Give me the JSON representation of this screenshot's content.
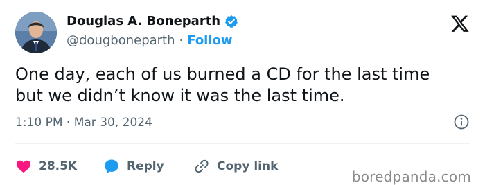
{
  "author": {
    "display_name": "Douglas A. Boneparth",
    "handle": "@dougboneparth",
    "separator": "·",
    "follow_label": "Follow"
  },
  "tweet": {
    "text": "One day, each of us burned a CD for the last time\nbut we didn’t know it was the last time.",
    "timestamp": "1:10 PM · Mar 30, 2024"
  },
  "actions": {
    "like_count": "28.5K",
    "reply_label": "Reply",
    "copy_link_label": "Copy link"
  },
  "watermark": "boredpanda.com",
  "icons": {
    "verified": "verified-badge-icon",
    "logo": "x-logo-icon",
    "info": "info-icon",
    "like": "heart-icon",
    "reply": "speech-bubble-icon",
    "copy": "link-icon"
  },
  "colors": {
    "accent": "#1d9bf0",
    "like": "#f91880",
    "text": "#0f1419",
    "muted": "#536471"
  }
}
